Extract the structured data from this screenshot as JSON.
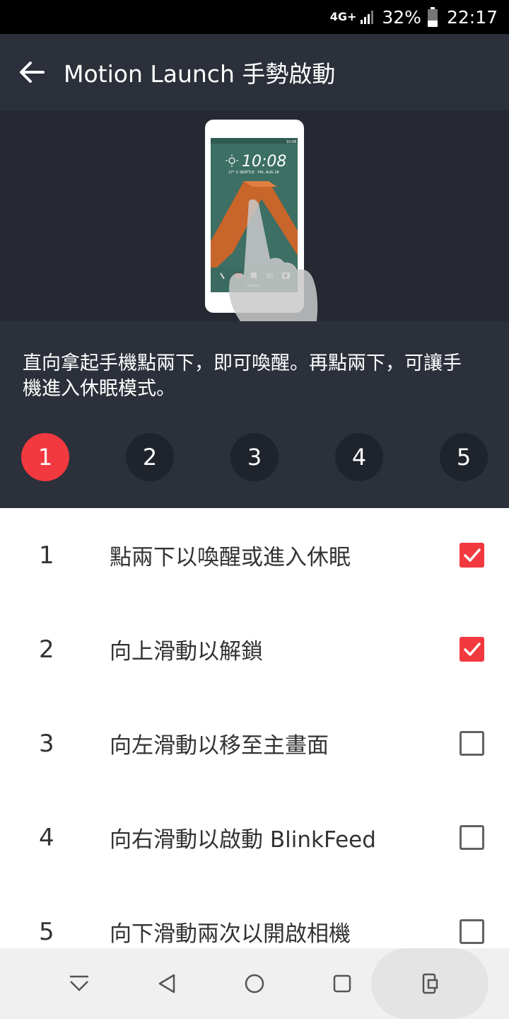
{
  "status_bar": {
    "network": "4G+",
    "battery": "32%",
    "time": "22:17"
  },
  "header": {
    "back_icon": "arrow-left-icon",
    "title": "Motion Launch 手勢啟動"
  },
  "illustration": {
    "clock_time": "10:08",
    "weather_line": "27° ⚲ SEATTLE · FRI, AUG 28",
    "status_time": "10:08",
    "carrier": "Operator"
  },
  "description": "直向拿起手機點兩下，即可喚醒。再點兩下，可讓手機進入休眠模式。",
  "steps": [
    {
      "label": "1",
      "active": true
    },
    {
      "label": "2",
      "active": false
    },
    {
      "label": "3",
      "active": false
    },
    {
      "label": "4",
      "active": false
    },
    {
      "label": "5",
      "active": false
    }
  ],
  "gestures": [
    {
      "number": "1",
      "label": "點兩下以喚醒或進入休眠",
      "checked": true
    },
    {
      "number": "2",
      "label": "向上滑動以解鎖",
      "checked": true
    },
    {
      "number": "3",
      "label": "向左滑動以移至主畫面",
      "checked": false
    },
    {
      "number": "4",
      "label": "向右滑動以啟動 BlinkFeed",
      "checked": false
    },
    {
      "number": "5",
      "label": "向下滑動兩次以開啟相機",
      "checked": false
    }
  ],
  "nav_bar": {
    "icons": [
      "hide-nav-icon",
      "back-triangle-icon",
      "home-circle-icon",
      "recents-square-icon",
      "rotate-phone-icon"
    ]
  },
  "colors": {
    "accent": "#f2393f",
    "header_bg": "#2b303a",
    "illustration_bg": "#262932",
    "step_bg": "#1f232b"
  }
}
